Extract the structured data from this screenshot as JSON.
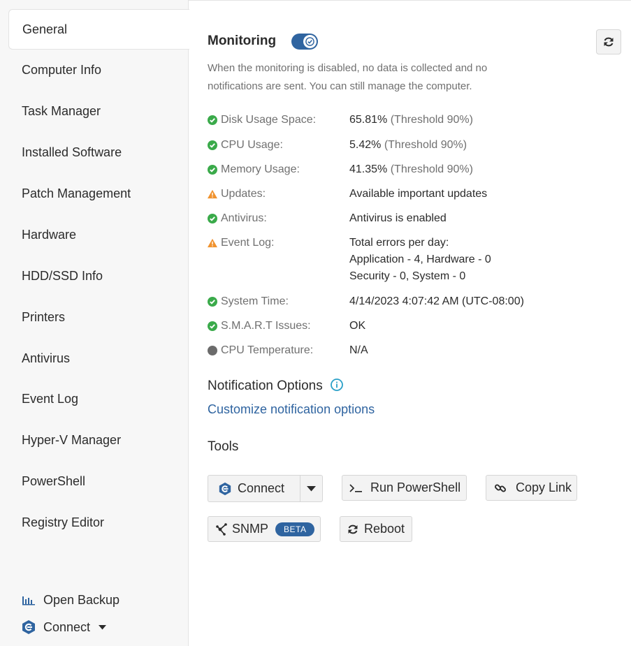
{
  "sidebar": {
    "items": [
      {
        "label": "General"
      },
      {
        "label": "Computer Info"
      },
      {
        "label": "Task Manager"
      },
      {
        "label": "Installed Software"
      },
      {
        "label": "Patch Management"
      },
      {
        "label": "Hardware"
      },
      {
        "label": "HDD/SSD Info"
      },
      {
        "label": "Printers"
      },
      {
        "label": "Antivirus"
      },
      {
        "label": "Event Log"
      },
      {
        "label": "Hyper-V Manager"
      },
      {
        "label": "PowerShell"
      },
      {
        "label": "Registry Editor"
      }
    ],
    "open_backup_label": "Open Backup",
    "connect_label": "Connect"
  },
  "monitoring": {
    "title": "Monitoring",
    "enabled": true,
    "description": "When the monitoring is disabled, no data is collected and no notifications are sent. You can still manage the computer."
  },
  "metrics": [
    {
      "status": "ok",
      "label": "Disk Usage Space:",
      "value": "65.81%",
      "note": " (Threshold 90%)"
    },
    {
      "status": "ok",
      "label": "CPU Usage:",
      "value": "5.42%",
      "note": " (Threshold 90%)"
    },
    {
      "status": "ok",
      "label": "Memory Usage:",
      "value": "41.35%",
      "note": " (Threshold 90%)"
    },
    {
      "status": "warning",
      "label": "Updates:",
      "value": "Available important updates",
      "note": ""
    },
    {
      "status": "ok",
      "label": "Antivirus:",
      "value": "Antivirus is enabled",
      "note": ""
    },
    {
      "status": "warning",
      "label": "Event Log:",
      "value_lines": [
        "Total errors per day:",
        "Application - 4, Hardware - 0",
        "Security - 0, System - 0"
      ]
    },
    {
      "status": "ok",
      "label": "System Time:",
      "value": "4/14/2023 4:07:42 AM (UTC-08:00)",
      "note": ""
    },
    {
      "status": "ok",
      "label": "S.M.A.R.T Issues:",
      "value": "OK",
      "note": ""
    },
    {
      "status": "unknown",
      "label": "CPU Temperature:",
      "value": "N/A",
      "note": ""
    }
  ],
  "notifications": {
    "title": "Notification Options",
    "link": "Customize notification options"
  },
  "tools": {
    "title": "Tools",
    "connect": "Connect",
    "run_powershell": "Run PowerShell",
    "copy_link": "Copy Link",
    "snmp": "SNMP",
    "snmp_badge": "BETA",
    "reboot": "Reboot"
  },
  "colors": {
    "accent": "#2f64a0",
    "ok": "#3aaa4a",
    "warning": "#f0922e",
    "unknown": "#6b6b6b",
    "info": "#2aa0c8"
  }
}
